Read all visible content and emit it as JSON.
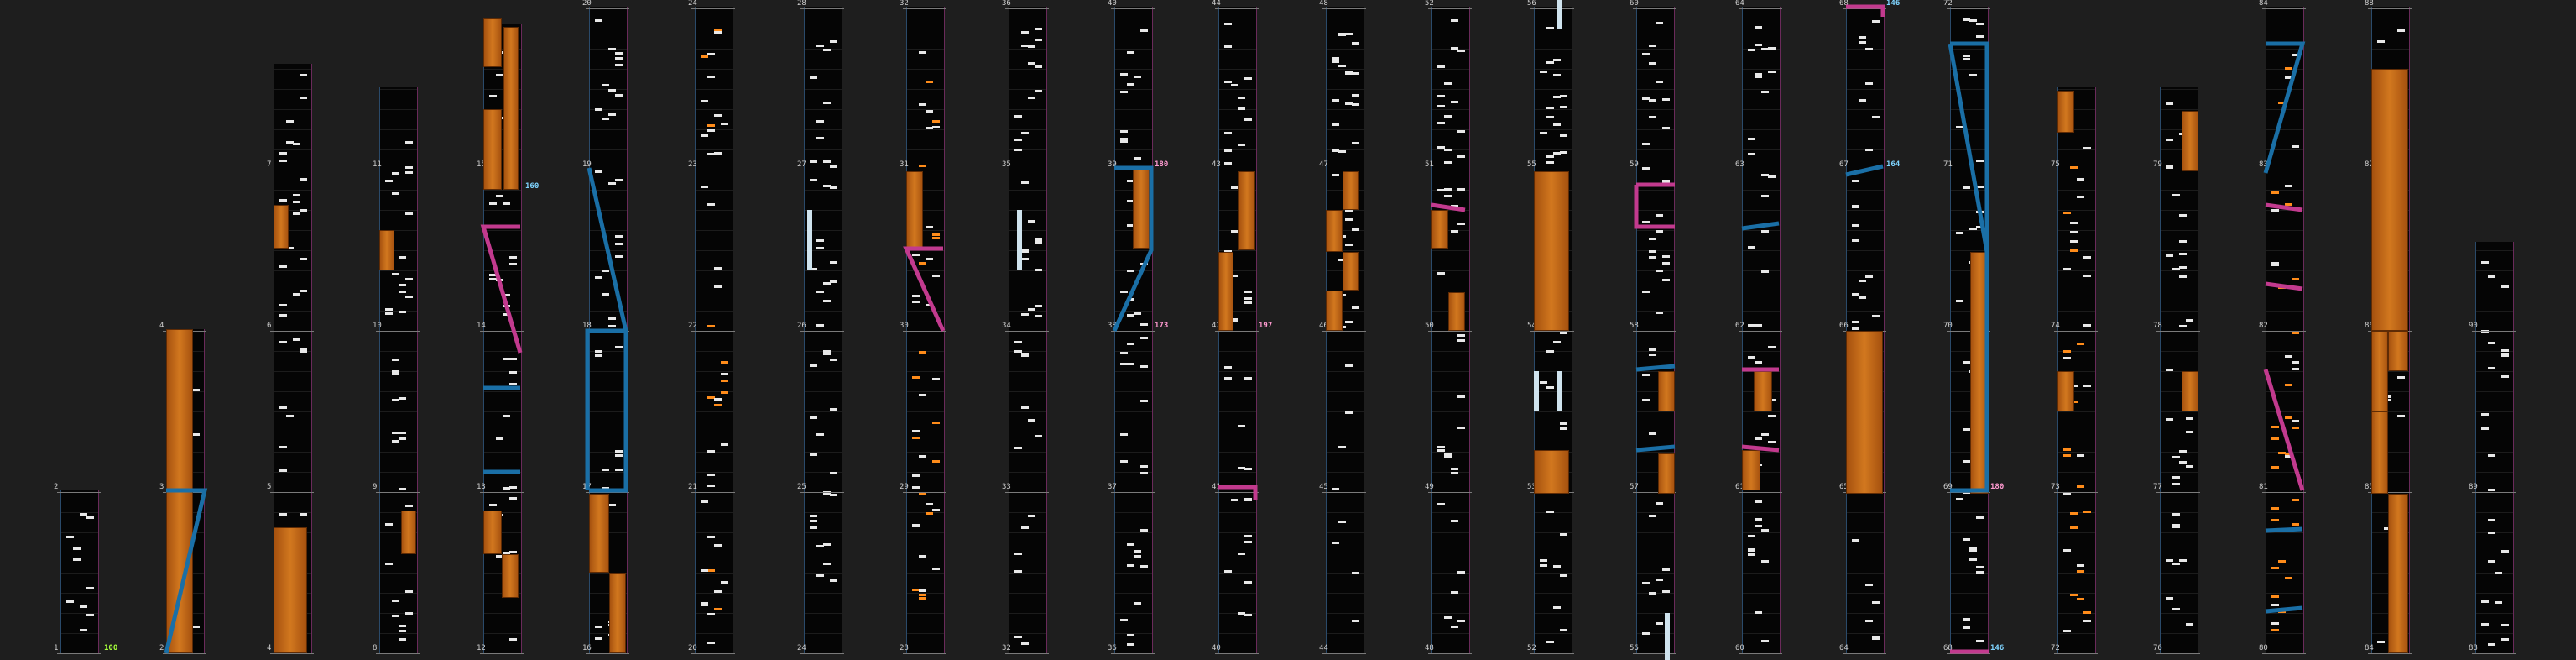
{
  "chart_view": {
    "colors": {
      "background": "#1e1e1e",
      "lane": "#050505",
      "note": "#e8e8e8",
      "note_accent": "#ff8c1a",
      "hold": "#d2781f",
      "blue_curve": "#1a6fa6",
      "magenta_curve": "#c23a8e",
      "bpm_green": "#a6ff3a",
      "bpm_blue": "#7fd4ff",
      "bpm_pink": "#ff9ad0"
    },
    "columns": [
      {
        "id": "c0",
        "bars": [
          "1",
          "2"
        ]
      },
      {
        "id": "c1",
        "bars": [
          "2",
          "3",
          "4"
        ]
      },
      {
        "id": "c2",
        "bars": [
          "4",
          "5",
          "6",
          "7",
          "8"
        ]
      },
      {
        "id": "c3",
        "bars": [
          "8",
          "9",
          "10",
          "11",
          "12"
        ]
      },
      {
        "id": "c4",
        "bars": [
          "12",
          "13",
          "14",
          "15",
          "16"
        ]
      },
      {
        "id": "c5",
        "bars": [
          "16",
          "17",
          "18",
          "19",
          "20"
        ]
      },
      {
        "id": "c6",
        "bars": [
          "20",
          "21",
          "22",
          "23",
          "24"
        ]
      },
      {
        "id": "c7",
        "bars": [
          "24",
          "25",
          "26",
          "27",
          "28"
        ]
      },
      {
        "id": "c8",
        "bars": [
          "28",
          "29",
          "30",
          "31",
          "32"
        ]
      },
      {
        "id": "c9",
        "bars": [
          "32",
          "33",
          "34",
          "35",
          "36"
        ]
      },
      {
        "id": "c10",
        "bars": [
          "36",
          "37",
          "38",
          "39",
          "40"
        ]
      },
      {
        "id": "c11",
        "bars": [
          "40",
          "41",
          "42",
          "43",
          "44"
        ]
      },
      {
        "id": "c12",
        "bars": [
          "44",
          "45",
          "46",
          "47",
          "48"
        ]
      },
      {
        "id": "c13",
        "bars": [
          "48",
          "49",
          "50",
          "51",
          "52"
        ]
      },
      {
        "id": "c14",
        "bars": [
          "52",
          "53",
          "54",
          "55",
          "56"
        ]
      },
      {
        "id": "c15",
        "bars": [
          "56",
          "57",
          "58",
          "59",
          "60"
        ]
      },
      {
        "id": "c16",
        "bars": [
          "60",
          "61",
          "62",
          "63",
          "64"
        ]
      },
      {
        "id": "c17",
        "bars": [
          "64",
          "65",
          "66",
          "67",
          "68"
        ]
      },
      {
        "id": "c18",
        "bars": [
          "68",
          "69",
          "70",
          "71",
          "72"
        ]
      },
      {
        "id": "c19",
        "bars": [
          "72",
          "73",
          "74",
          "75",
          "76"
        ]
      },
      {
        "id": "c20",
        "bars": [
          "76",
          "77",
          "78",
          "79",
          "80"
        ]
      },
      {
        "id": "c21",
        "bars": [
          "80",
          "81",
          "82",
          "83",
          "84"
        ]
      },
      {
        "id": "c22",
        "bars": [
          "84",
          "85",
          "86",
          "87",
          "88"
        ]
      },
      {
        "id": "c23",
        "bars": [
          "88",
          "89",
          "90"
        ]
      }
    ],
    "bpm_labels": [
      {
        "id": "b1",
        "text": "100"
      },
      {
        "id": "b2",
        "text": "160"
      },
      {
        "id": "b3",
        "text": "180"
      },
      {
        "id": "b4",
        "text": "173"
      },
      {
        "id": "b5",
        "text": "197"
      },
      {
        "id": "b6",
        "text": "146"
      },
      {
        "id": "b7",
        "text": "164"
      },
      {
        "id": "b8",
        "text": "180"
      },
      {
        "id": "b9",
        "text": "146"
      }
    ]
  }
}
